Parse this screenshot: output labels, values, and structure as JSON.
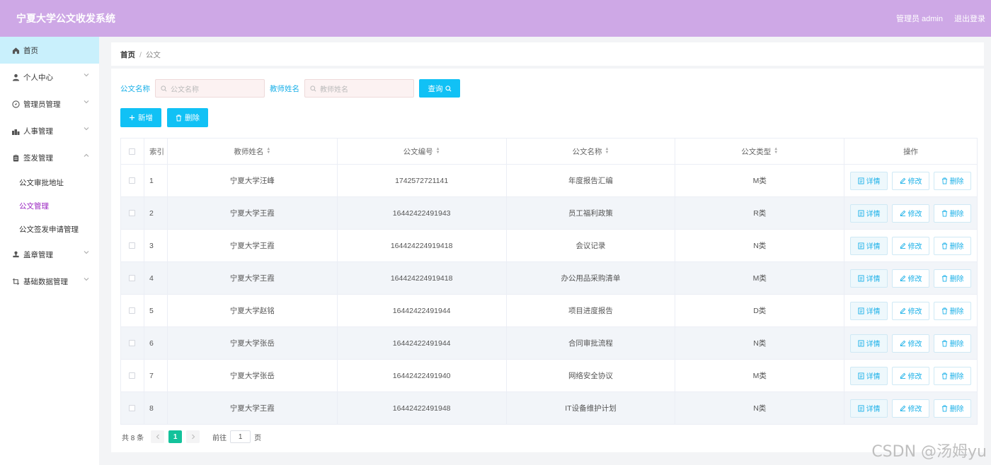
{
  "header": {
    "title": "宁夏大学公文收发系统",
    "admin_label": "管理员 admin",
    "logout_label": "退出登录"
  },
  "sidebar": {
    "items": [
      {
        "label": "首页",
        "icon": "home-icon"
      },
      {
        "label": "个人中心",
        "icon": "user-icon"
      },
      {
        "label": "管理员管理",
        "icon": "compass-icon"
      },
      {
        "label": "人事管理",
        "icon": "group-icon"
      },
      {
        "label": "签发管理",
        "icon": "clipboard-icon"
      },
      {
        "label": "盖章管理",
        "icon": "stamp-icon"
      },
      {
        "label": "基础数据管理",
        "icon": "crop-icon"
      }
    ],
    "submenu": [
      "公文审批地址",
      "公文管理",
      "公文签发申请管理"
    ]
  },
  "breadcrumb": {
    "home": "首页",
    "sep": "/",
    "current": "公文"
  },
  "search": {
    "doc_name_label": "公文名称",
    "doc_name_placeholder": "公文名称",
    "teacher_label": "教师姓名",
    "teacher_placeholder": "教师姓名",
    "query_label": "查询"
  },
  "actions": {
    "add_label": "新增",
    "delete_label": "删除"
  },
  "table": {
    "headers": {
      "index": "索引",
      "teacher": "教师姓名",
      "doc_no": "公文编号",
      "doc_name": "公文名称",
      "doc_type": "公文类型",
      "ops": "操作"
    },
    "op_labels": {
      "detail": "详情",
      "edit": "修改",
      "delete": "删除"
    },
    "rows": [
      {
        "index": "1",
        "teacher": "宁夏大学汪峰",
        "doc_no": "1742572721141",
        "doc_name": "年度报告汇编",
        "doc_type": "M类"
      },
      {
        "index": "2",
        "teacher": "宁夏大学王霞",
        "doc_no": "16442422491943",
        "doc_name": "员工福利政策",
        "doc_type": "R类"
      },
      {
        "index": "3",
        "teacher": "宁夏大学王霞",
        "doc_no": "164424224919418",
        "doc_name": "会议记录",
        "doc_type": "N类"
      },
      {
        "index": "4",
        "teacher": "宁夏大学王霞",
        "doc_no": "164424224919418",
        "doc_name": "办公用品采购清单",
        "doc_type": "M类"
      },
      {
        "index": "5",
        "teacher": "宁夏大学赵铭",
        "doc_no": "16442422491944",
        "doc_name": "项目进度报告",
        "doc_type": "D类"
      },
      {
        "index": "6",
        "teacher": "宁夏大学张岳",
        "doc_no": "16442422491944",
        "doc_name": "合同审批流程",
        "doc_type": "N类"
      },
      {
        "index": "7",
        "teacher": "宁夏大学张岳",
        "doc_no": "16442422491940",
        "doc_name": "网络安全协议",
        "doc_type": "M类"
      },
      {
        "index": "8",
        "teacher": "宁夏大学王霞",
        "doc_no": "16442422491948",
        "doc_name": "IT设备维护计划",
        "doc_type": "N类"
      }
    ]
  },
  "pagination": {
    "total": "共 8 条",
    "current_page": "1",
    "goto_label": "前往",
    "goto_value": "1",
    "page_unit": "页"
  },
  "watermark": "CSDN @汤姆yu",
  "colors": {
    "header": "#cea8e6",
    "accent": "#11c1f5",
    "active_sub": "#9b27c2",
    "page_active": "#13c29b"
  }
}
